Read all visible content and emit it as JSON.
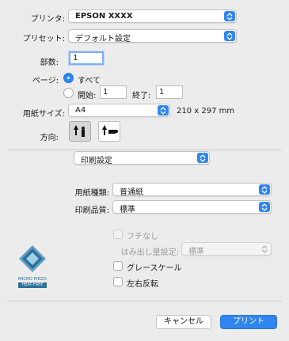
{
  "printer": {
    "label": "プリンタ:",
    "value": "EPSON XXXX"
  },
  "preset": {
    "label": "プリセット:",
    "value": "デフォルト設定"
  },
  "copies": {
    "label": "部数:",
    "value": "1"
  },
  "pages": {
    "label": "ページ:",
    "all_label": "すべて",
    "from_label": "開始:",
    "from_value": "1",
    "to_label": "終了:",
    "to_value": "1",
    "selected": "all"
  },
  "paper_size": {
    "label": "用紙サイズ:",
    "value": "A4",
    "dimensions": "210 x 297 mm"
  },
  "orientation": {
    "label": "方向:",
    "selected": "portrait"
  },
  "section": {
    "value": "印刷設定"
  },
  "media_type": {
    "label": "用紙種類:",
    "value": "普通紙"
  },
  "print_quality": {
    "label": "印刷品質:",
    "value": "標準"
  },
  "borderless": {
    "label": "フチなし",
    "checked": false,
    "enabled": false
  },
  "expansion": {
    "label": "はみ出し量設定:",
    "value": "標準",
    "enabled": false
  },
  "grayscale": {
    "label": "グレースケール",
    "checked": false
  },
  "mirror": {
    "label": "左右反転",
    "checked": false
  },
  "logo": {
    "line1": "MICRO PIEZO",
    "line2": "HEAT-FREE"
  },
  "buttons": {
    "cancel": "キャンセル",
    "print": "プリント"
  },
  "colors": {
    "accent": "#2f86f0",
    "background": "#ececec"
  },
  "icons": {
    "stepper": "up-down-chevron-icon"
  }
}
